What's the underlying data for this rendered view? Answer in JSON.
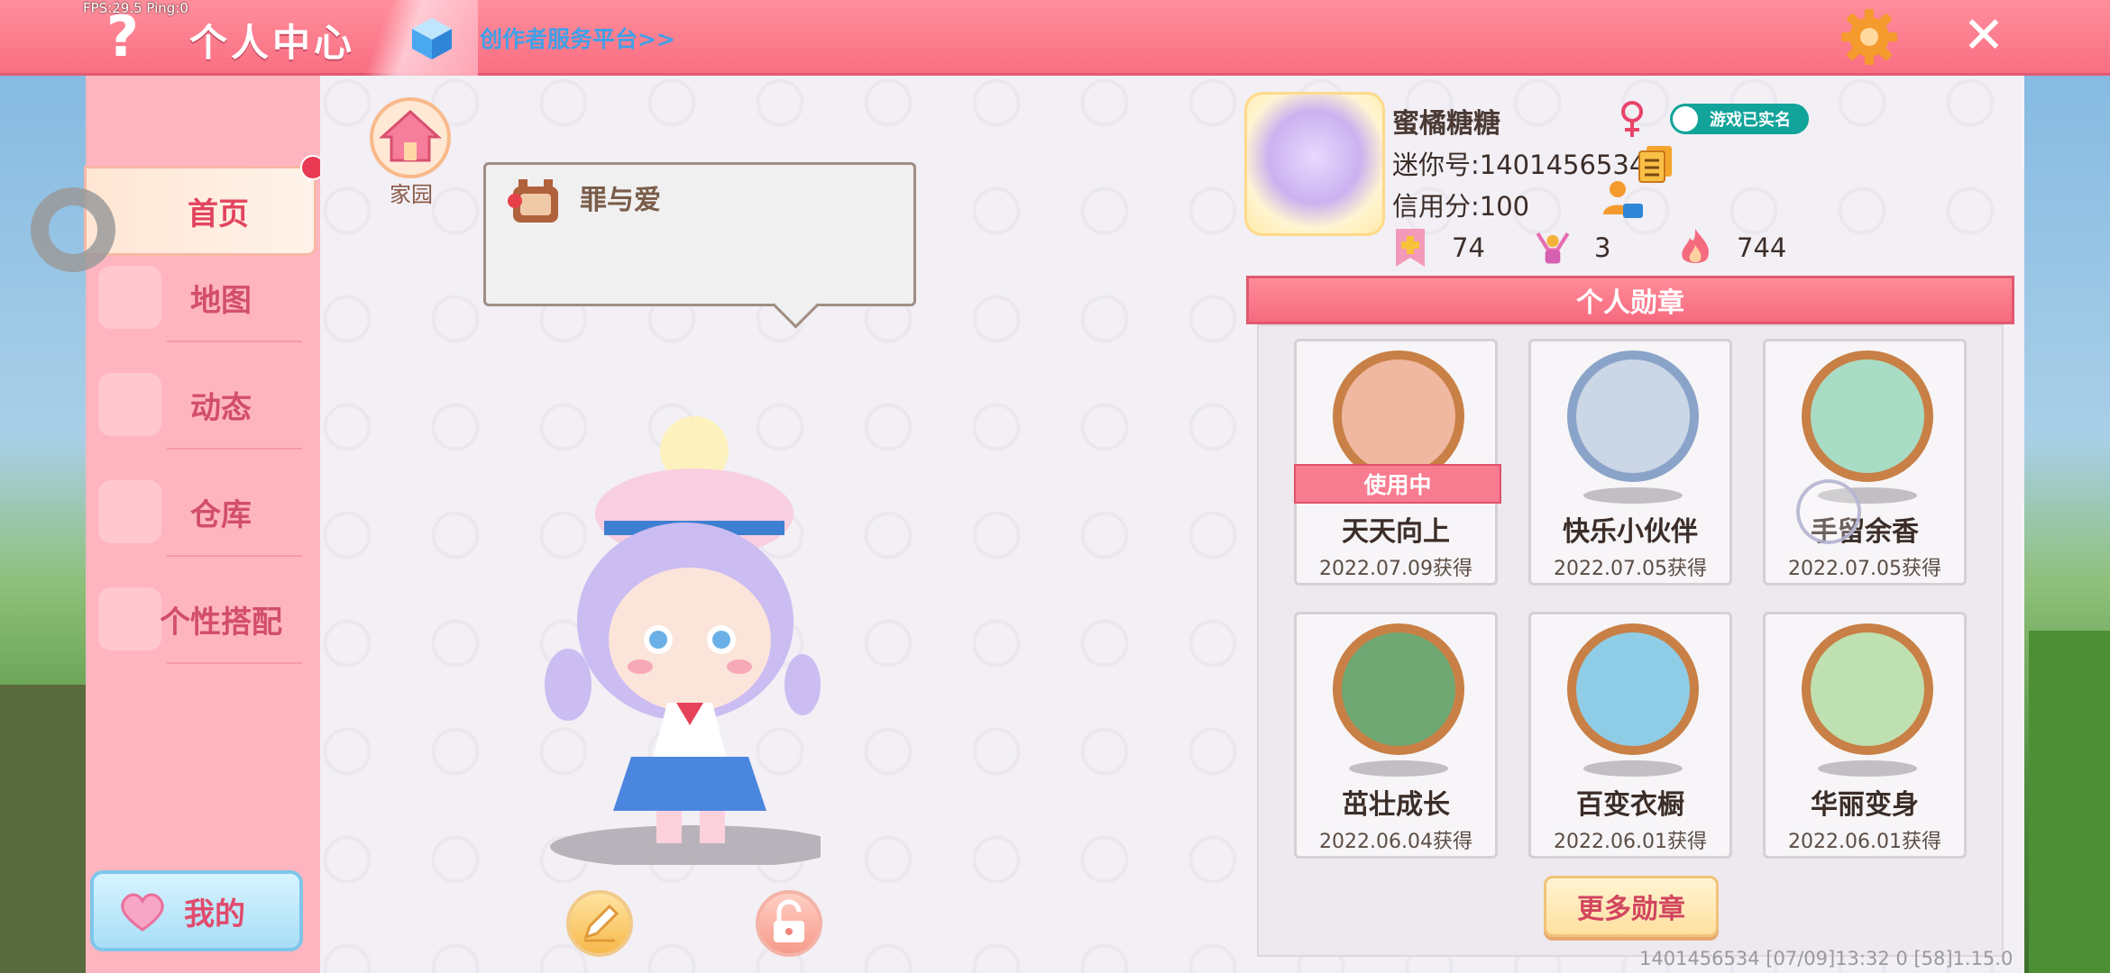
{
  "debug": {
    "fps_text": "FPS:29.5  Ping:0"
  },
  "topbar": {
    "title": "个人中心",
    "creator_link": "创作者服务平台>>"
  },
  "nav": {
    "items": [
      {
        "label": "首页",
        "active": true
      },
      {
        "label": "地图"
      },
      {
        "label": "动态"
      },
      {
        "label": "仓库"
      },
      {
        "label": "个性搭配"
      }
    ],
    "mine_label": "我的"
  },
  "home": {
    "label": "家园"
  },
  "speech_bubble": {
    "text": "罪与爱"
  },
  "profile": {
    "nickname": "蜜橘糖糖",
    "verified_label": "游戏已实名",
    "mini_id": "迷你号:1401456534",
    "credit": "信用分:100",
    "stats": [
      {
        "icon": "bookmark-plus-icon",
        "value": "74"
      },
      {
        "icon": "cheer-icon",
        "value": "3"
      },
      {
        "icon": "flame-icon",
        "value": "744"
      }
    ]
  },
  "medals": {
    "header": "个人勋章",
    "in_use_label": "使用中",
    "items": [
      {
        "name": "天天向上",
        "date": "2022.07.09获得",
        "style": "bronze"
      },
      {
        "name": "快乐小伙伴",
        "date": "2022.07.05获得",
        "style": "silver"
      },
      {
        "name": "手留余香",
        "date": "2022.07.05获得",
        "style": "bronze"
      },
      {
        "name": "茁壮成长",
        "date": "2022.06.04获得",
        "style": "bronze"
      },
      {
        "name": "百变衣橱",
        "date": "2022.06.01获得",
        "style": "bronze"
      },
      {
        "name": "华丽变身",
        "date": "2022.06.01获得",
        "style": "bronze"
      }
    ],
    "more_label": "更多勋章"
  },
  "footer": {
    "info": "1401456534   [07/09]13:32 0   [58]1.15.0"
  },
  "colors": {
    "topbar": "#f96e82",
    "nav_bg": "#ffb5bf",
    "accent_text": "#d24e6c",
    "verified": "#12a39a",
    "link": "#3fa0e8"
  }
}
